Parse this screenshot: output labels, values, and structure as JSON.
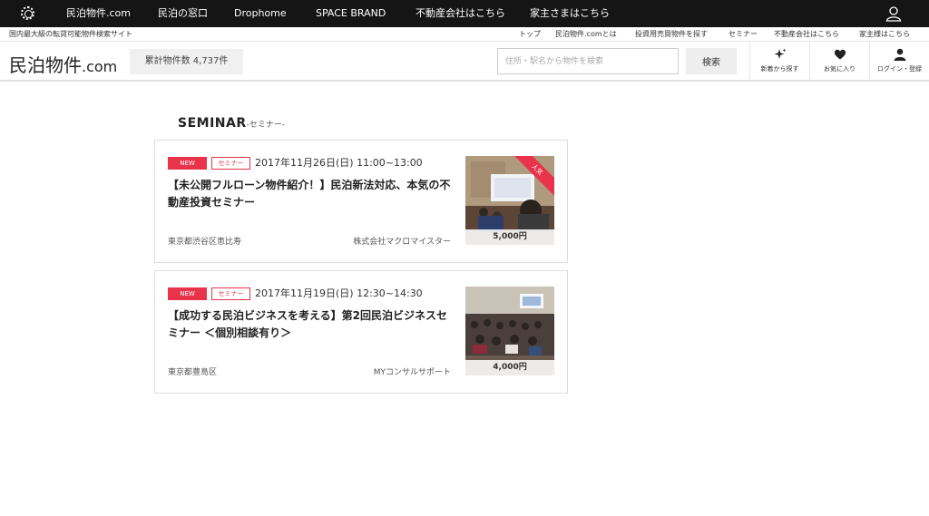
{
  "topnav": {
    "items": [
      "民泊物件.com",
      "民泊の窓口",
      "Drophome",
      "SPACE BRAND",
      "不動産会社はこちら",
      "家主さまはこちら"
    ]
  },
  "subbar": {
    "tagline": "国内最大級の転貸可能物件検索サイト",
    "links": [
      "トップ",
      "民泊物件.comとは",
      "投資用売買物件を探す",
      "セミナー",
      "不動産会社はこちら",
      "家主様はこちら"
    ]
  },
  "header": {
    "logo_main": "民泊物件",
    "logo_suffix": ".com",
    "count_label": "累計物件数 4,737件",
    "search_placeholder": "住所・駅名から物件を検索",
    "search_button": "検索",
    "buttons": [
      {
        "label": "新着から探す",
        "icon": "sparkle-icon"
      },
      {
        "label": "お気に入り",
        "icon": "heart-icon"
      },
      {
        "label": "ログイン・登録",
        "icon": "person-icon"
      }
    ]
  },
  "section": {
    "title": "SEMINAR",
    "subtitle": "-セミナー-"
  },
  "seminars": [
    {
      "badge_new": "NEW",
      "badge_category": "セミナー",
      "date": "2017年11月26日(日) 11:00~13:00",
      "title": "【未公開フルローン物件紹介！】民泊新法対応、本気の不動産投資セミナー",
      "location": "東京都渋谷区恵比寿",
      "organizer": "株式会社マクロマイスター",
      "price": "5,000円",
      "ribbon": "人気"
    },
    {
      "badge_new": "NEW",
      "badge_category": "セミナー",
      "date": "2017年11月19日(日) 12:30~14:30",
      "title": "【成功する民泊ビジネスを考える】第2回民泊ビジネスセミナー ＜個別相談有り＞",
      "location": "東京都豊島区",
      "organizer": "MYコンサルサポート",
      "price": "4,000円"
    }
  ],
  "colors": {
    "topbar": "#151515",
    "accent": "#e8334a"
  }
}
